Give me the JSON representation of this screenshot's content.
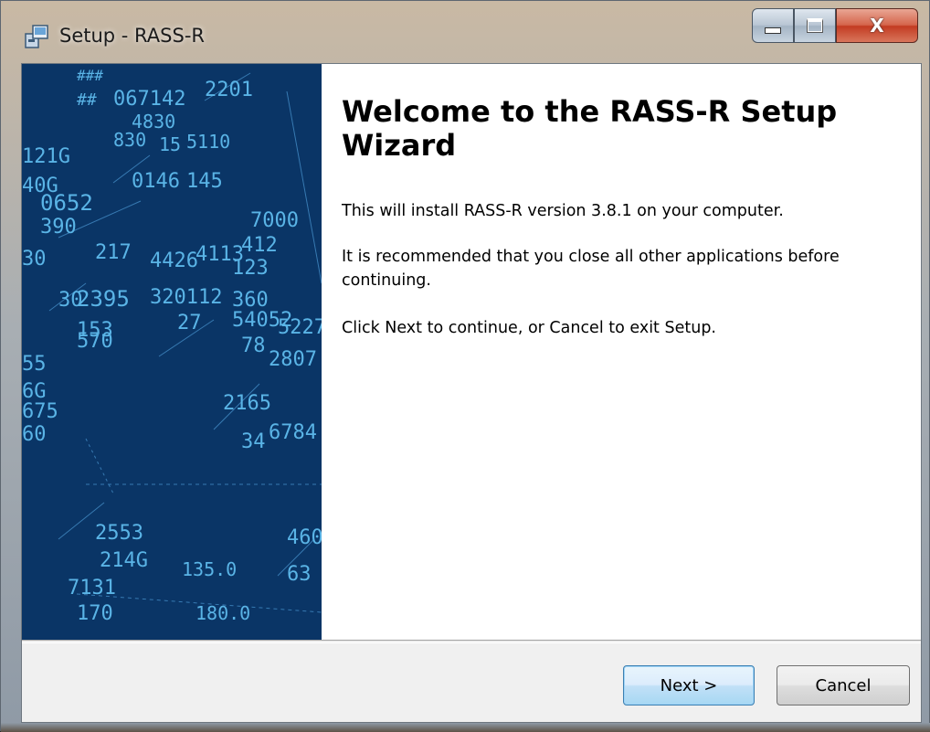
{
  "window": {
    "title": "Setup - RASS-R",
    "icon": "setup-installer-icon",
    "minimize_glyph": "–",
    "close_glyph": "X"
  },
  "welcome": {
    "heading": "Welcome to the RASS-R Setup Wizard",
    "install_text": "This will install RASS-R version 3.8.1 on your computer.",
    "recommend_text": "It is recommended that you close all other applications before continuing.",
    "instruction_text": "Click Next to continue, or Cancel to exit Setup."
  },
  "buttons": {
    "next_label": "Next >",
    "cancel_label": "Cancel"
  },
  "side_image": {
    "description_icon": "radar-display-image",
    "background_color": "#0a3566",
    "text_color": "#5ab4e6",
    "labels": [
      "###",
      "067142",
      "##",
      "2201",
      "4830",
      "830",
      "15",
      "5110",
      "121G",
      "40G",
      "0146",
      "145",
      "0652",
      "7000",
      "390",
      "30",
      "217",
      "4426",
      "4113",
      "412",
      "123",
      "30",
      "2395",
      "320112",
      "360",
      "153",
      "27",
      "54052",
      "5227",
      "570",
      "55",
      "78",
      "2807",
      "6G",
      "675",
      "60",
      "2165",
      "34",
      "6784",
      "2553",
      "214G",
      "135.0",
      "63",
      "7131",
      "170",
      "180.0",
      "460"
    ]
  }
}
